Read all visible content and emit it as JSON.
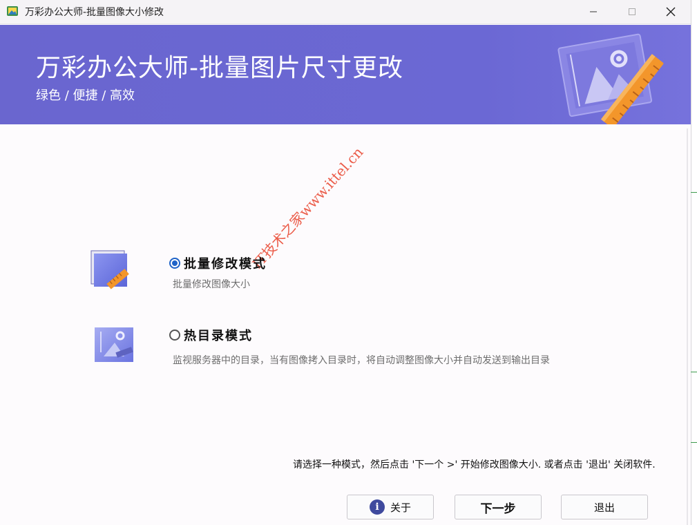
{
  "window": {
    "title": "万彩办公大师-批量图像大小修改"
  },
  "header": {
    "title": "万彩办公大师-批量图片尺寸更改",
    "subtitle": "绿色 / 便捷 / 高效"
  },
  "modes": [
    {
      "label": "批量修改模式",
      "description": "批量修改图像大小",
      "selected": true
    },
    {
      "label": "热目录模式",
      "description": "监视服务器中的目录，当有图像拷入目录时，将自动调整图像大小并自动发送到输出目录",
      "selected": false
    }
  ],
  "hint": "请选择一种模式，然后点击 '下一个 >' 开始修改图像大小. 或者点击 '退出' 关闭软件.",
  "buttons": {
    "about": "关于",
    "next": "下一步",
    "exit": "退出"
  },
  "watermark": "IT技术之家www.ittel.cn",
  "colors": {
    "header_bg": "#6a66cf",
    "radio_accent": "#1f63c8",
    "watermark": "#ea4f3a"
  },
  "icons": {
    "app": "photo-app-icon",
    "minimize": "minimize-icon",
    "maximize": "maximize-icon",
    "close": "close-icon",
    "header_art": "picture-ruler-icon",
    "mode1": "batch-resize-icon",
    "mode2": "hot-folder-icon",
    "about": "info-icon"
  }
}
